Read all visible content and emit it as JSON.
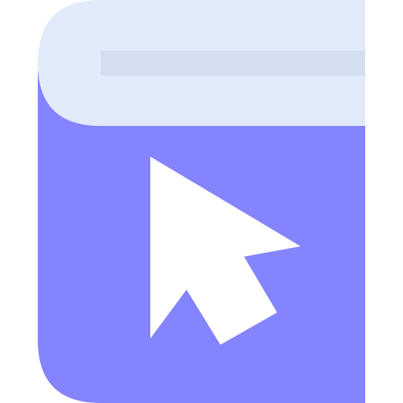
{
  "icon": {
    "name": "book-cursor-icon",
    "parts": {
      "cover": "book-cover",
      "pages": "book-pages",
      "page_line": "page-line",
      "pointer": "cursor-arrow-icon"
    }
  },
  "colors": {
    "background": "#ffffff",
    "cover": "#8484ff",
    "pages": "#e1ebfa",
    "page_line": "#d3def0",
    "pointer": "#ffffff"
  }
}
